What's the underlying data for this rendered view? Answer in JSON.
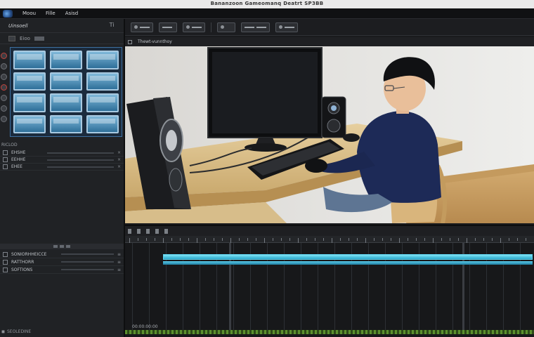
{
  "window": {
    "title": "Bananzoon Gameomanq Deatrt SP3BB"
  },
  "menu": {
    "items": [
      "Moou",
      "Fille",
      "Asisd"
    ]
  },
  "left_panel": {
    "header_label": "Uinsoell",
    "header_button": "Ti",
    "sub_label": "Eioo",
    "section_label": "RICLOD",
    "rows": [
      {
        "name": "EHSHE"
      },
      {
        "name": "EEHHE"
      },
      {
        "name": "EHEE"
      }
    ],
    "rows2": [
      {
        "name": "SONIORHHEICCE"
      },
      {
        "name": "RATTHORR"
      },
      {
        "name": "SOFTIONS"
      }
    ],
    "footer": "SEOLEDINE"
  },
  "toolbar": {
    "buttons": [
      "tb1",
      "tb2",
      "tb3",
      "tb4",
      "tb5",
      "tb6"
    ]
  },
  "preview": {
    "header_label": "Thewt-vunnthoy"
  },
  "timeline": {
    "timecode": "00:00:00:00"
  },
  "colors": {
    "accent": "#2aa7c9",
    "panel": "#202225",
    "background": "#1a1b1d"
  }
}
